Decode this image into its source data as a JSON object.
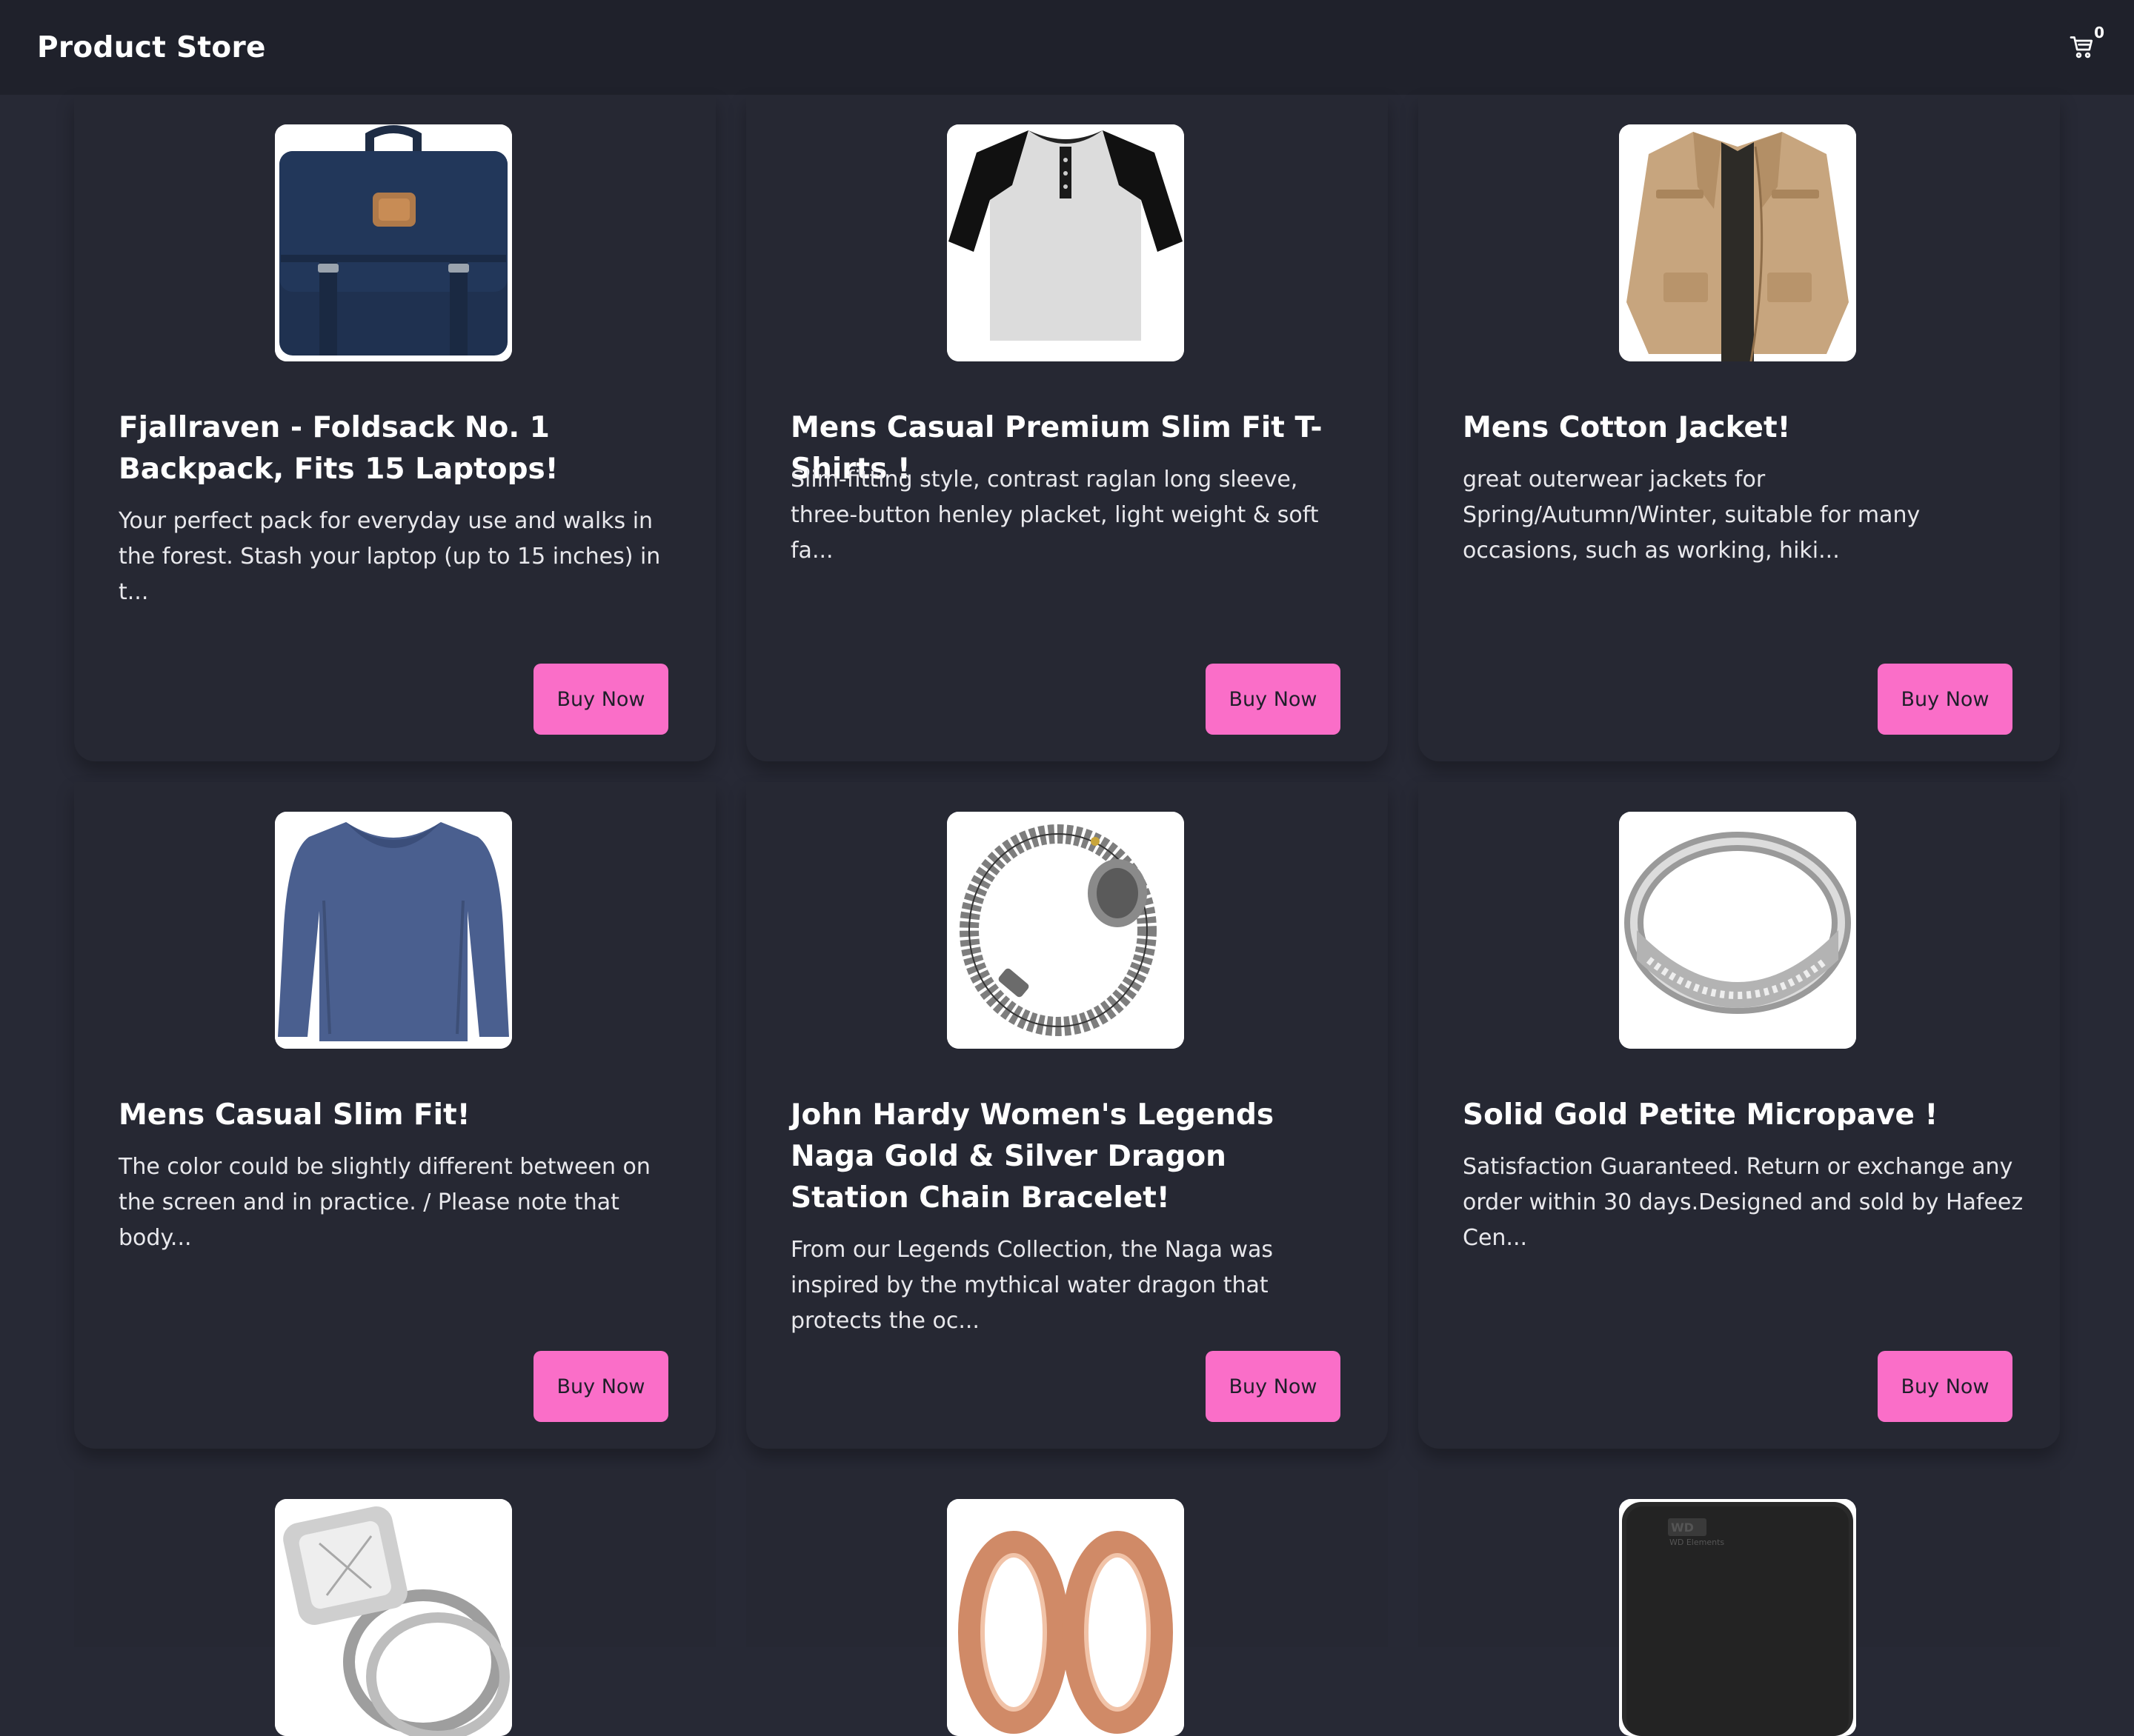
{
  "header": {
    "brand": "Product Store",
    "cart_count": "0",
    "cart_icon": "cart-icon"
  },
  "products": [
    {
      "title": "Fjallraven - Foldsack No. 1 Backpack, Fits 15 Laptops!",
      "description": "Your perfect pack for everyday use and walks in the forest. Stash your laptop (up to 15 inches) in t...",
      "button": "Buy Now",
      "image": "backpack"
    },
    {
      "title": "Mens Casual Premium Slim Fit T-Shirts !",
      "description": "Slim-fitting style, contrast raglan long sleeve, three-button henley placket, light weight & soft fa...",
      "button": "Buy Now",
      "image": "tshirt"
    },
    {
      "title": "Mens Cotton Jacket!",
      "description": "great outerwear jackets for Spring/Autumn/Winter, suitable for many occasions, such as working, hiki...",
      "button": "Buy Now",
      "image": "jacket"
    },
    {
      "title": "Mens Casual Slim Fit!",
      "description": "The color could be slightly different between on the screen and in practice. / Please note that body...",
      "button": "Buy Now",
      "image": "long-sleeve-shirt"
    },
    {
      "title": "John Hardy Women's Legends Naga Gold & Silver Dragon Station Chain Bracelet!",
      "description": "From our Legends Collection, the Naga was inspired by the mythical water dragon that protects the oc...",
      "button": "Buy Now",
      "image": "bracelet"
    },
    {
      "title": "Solid Gold Petite Micropave !",
      "description": "Satisfaction Guaranteed. Return or exchange any order within 30 days.Designed and sold by Hafeez Cen...",
      "button": "Buy Now",
      "image": "ring"
    },
    {
      "image": "diamond-ring"
    },
    {
      "image": "rose-gold-plugs"
    },
    {
      "image": "external-drive",
      "image_text": "WD Elements"
    }
  ]
}
